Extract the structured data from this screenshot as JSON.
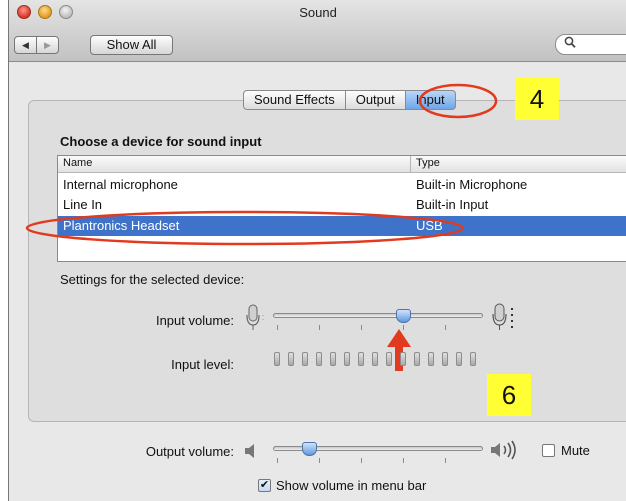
{
  "window": {
    "title": "Sound"
  },
  "toolbar": {
    "back_label": "◀",
    "forward_label": "▶",
    "show_all_label": "Show All",
    "search_icon": "search-icon"
  },
  "tabs": [
    {
      "label": "Sound Effects"
    },
    {
      "label": "Output"
    },
    {
      "label": "Input"
    }
  ],
  "selected_tab": "Input",
  "input": {
    "section_title": "Choose a device for sound input",
    "columns": [
      "Name",
      "Type"
    ],
    "devices": [
      {
        "name": "Internal microphone",
        "type": "Built-in Microphone"
      },
      {
        "name": "Line In",
        "type": "Built-in Input"
      },
      {
        "name": "Plantronics Headset",
        "type": "USB"
      }
    ],
    "selected_device": "Plantronics Headset",
    "settings_label": "Settings for the selected device:",
    "input_volume_label": "Input volume:",
    "input_volume_level": 0.63,
    "input_level_label": "Input level:",
    "input_level_segments": 15,
    "input_level_active": 0
  },
  "output": {
    "volume_label": "Output volume:",
    "volume_level": 0.15,
    "mute_label": "Mute",
    "mute_checked": false,
    "show_volume_label": "Show volume in menu bar",
    "show_volume_checked": true
  },
  "annotations": [
    {
      "text": "4"
    },
    {
      "text": "6"
    }
  ],
  "colors": {
    "selection": "#3f73c9",
    "callout": "#ffff33",
    "annotation_red": "#e23a1f"
  }
}
